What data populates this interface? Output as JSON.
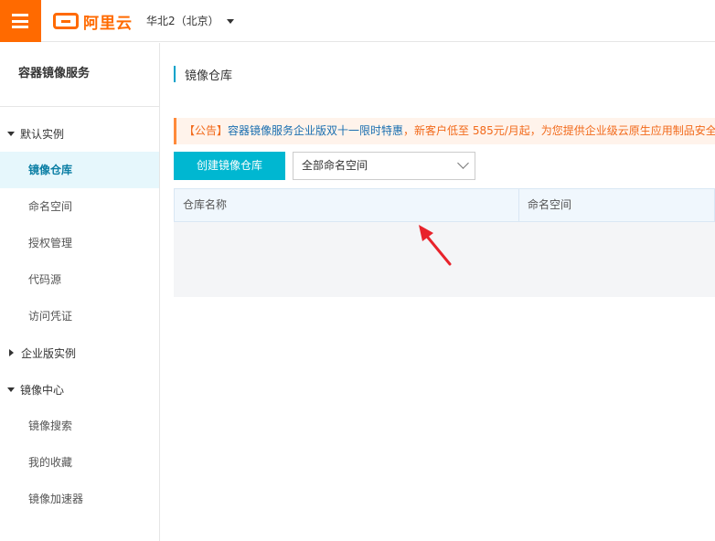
{
  "header": {
    "logo_text": "阿里云",
    "region": "华北2（北京）"
  },
  "sidebar": {
    "title": "容器镜像服务",
    "groups": [
      {
        "label": "默认实例",
        "expanded": true,
        "items": [
          {
            "label": "镜像仓库",
            "active": true
          },
          {
            "label": "命名空间"
          },
          {
            "label": "授权管理"
          },
          {
            "label": "代码源"
          },
          {
            "label": "访问凭证"
          }
        ]
      },
      {
        "label": "企业版实例",
        "expanded": false,
        "items": []
      },
      {
        "label": "镜像中心",
        "expanded": true,
        "items": [
          {
            "label": "镜像搜索"
          },
          {
            "label": "我的收藏"
          },
          {
            "label": "镜像加速器"
          }
        ]
      }
    ]
  },
  "main": {
    "page_title": "镜像仓库",
    "notice": {
      "prefix": "【公告】",
      "link": "容器镜像服务企业版",
      "highlight": "双十一限时特惠",
      "text": "，新客户低至 585元/月起，为您提供企业级云原生应用制品安全"
    },
    "create_button": "创建镜像仓库",
    "namespace_select": "全部命名空间",
    "table": {
      "columns": [
        "仓库名称",
        "命名空间"
      ]
    }
  },
  "colors": {
    "brand": "#ff6a00",
    "accent": "#00b7d1",
    "arrow": "#e8232b"
  }
}
